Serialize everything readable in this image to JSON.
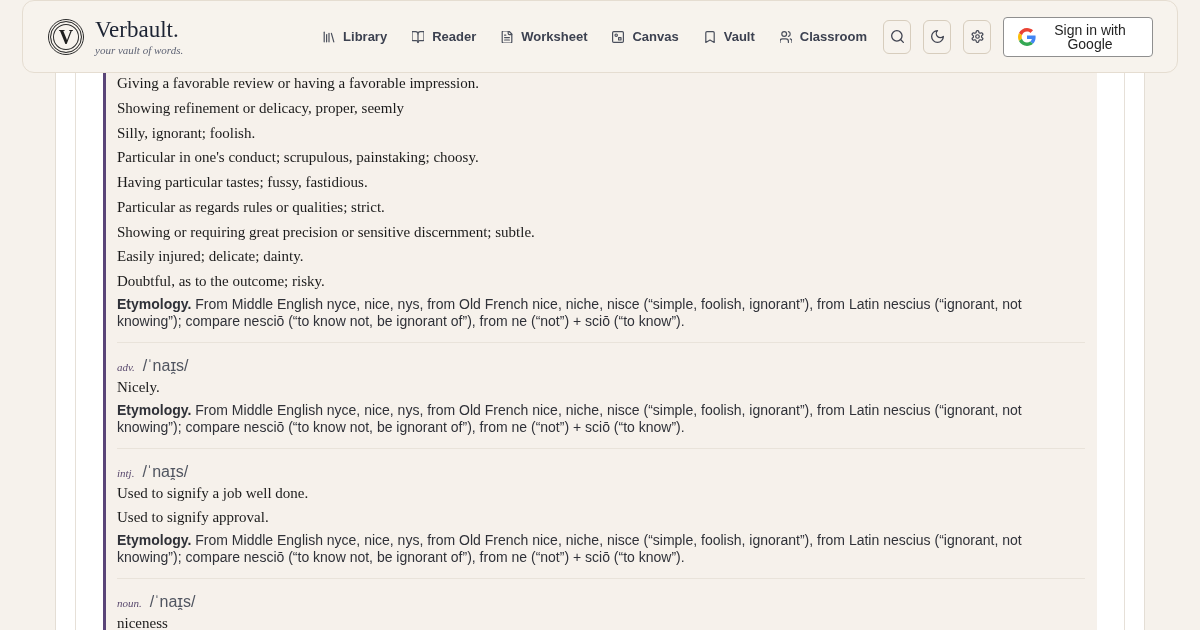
{
  "header": {
    "logo_letter": "V",
    "brand": "Verbault.",
    "tagline": "your vault of words.",
    "nav": [
      {
        "label": "Library"
      },
      {
        "label": "Reader"
      },
      {
        "label": "Worksheet"
      },
      {
        "label": "Canvas"
      },
      {
        "label": "Vault"
      },
      {
        "label": "Classroom"
      }
    ],
    "sign_in": {
      "label": "Sign in with Google"
    }
  },
  "entry": {
    "senses": [
      {
        "definitions": [
          "Giving a favorable review or having a favorable impression.",
          "Showing refinement or delicacy, proper, seemly",
          "Silly, ignorant; foolish.",
          "Particular in one's conduct; scrupulous, painstaking; choosy.",
          "Having particular tastes; fussy, fastidious.",
          "Particular as regards rules or qualities; strict.",
          "Showing or requiring great precision or sensitive discernment; subtle.",
          "Easily injured; delicate; dainty.",
          "Doubtful, as to the outcome; risky."
        ],
        "etymology": "**Etymology.** From Middle English nyce, nice, nys, from Old French nice, niche, nisce (“simple, foolish, ignorant”), from Latin nescius (“ignorant, not knowing”); compare nesciō (“to know not, be ignorant of”), from ne (“not”) + sciō (“to know”)."
      },
      {
        "pos": "adv.",
        "pronunciation": "/ˈnaɪ̯s/",
        "definitions": [
          "Nicely."
        ],
        "etymology": "**Etymology.** From Middle English nyce, nice, nys, from Old French nice, niche, nisce (“simple, foolish, ignorant”), from Latin nescius (“ignorant, not knowing”); compare nesciō (“to know not, be ignorant of”), from ne (“not”) + sciō (“to know”)."
      },
      {
        "pos": "intj.",
        "pronunciation": "/ˈnaɪ̯s/",
        "definitions": [
          "Used to signify a job well done.",
          "Used to signify approval."
        ],
        "etymology": "**Etymology.** From Middle English nyce, nice, nys, from Old French nice, niche, nisce (“simple, foolish, ignorant”), from Latin nescius (“ignorant, not knowing”); compare nesciō (“to know not, be ignorant of”), from ne (“not”) + sciō (“to know”)."
      },
      {
        "pos": "noun.",
        "pronunciation": "/ˈnaɪ̯s/",
        "definitions": [
          "niceness"
        ]
      }
    ]
  }
}
